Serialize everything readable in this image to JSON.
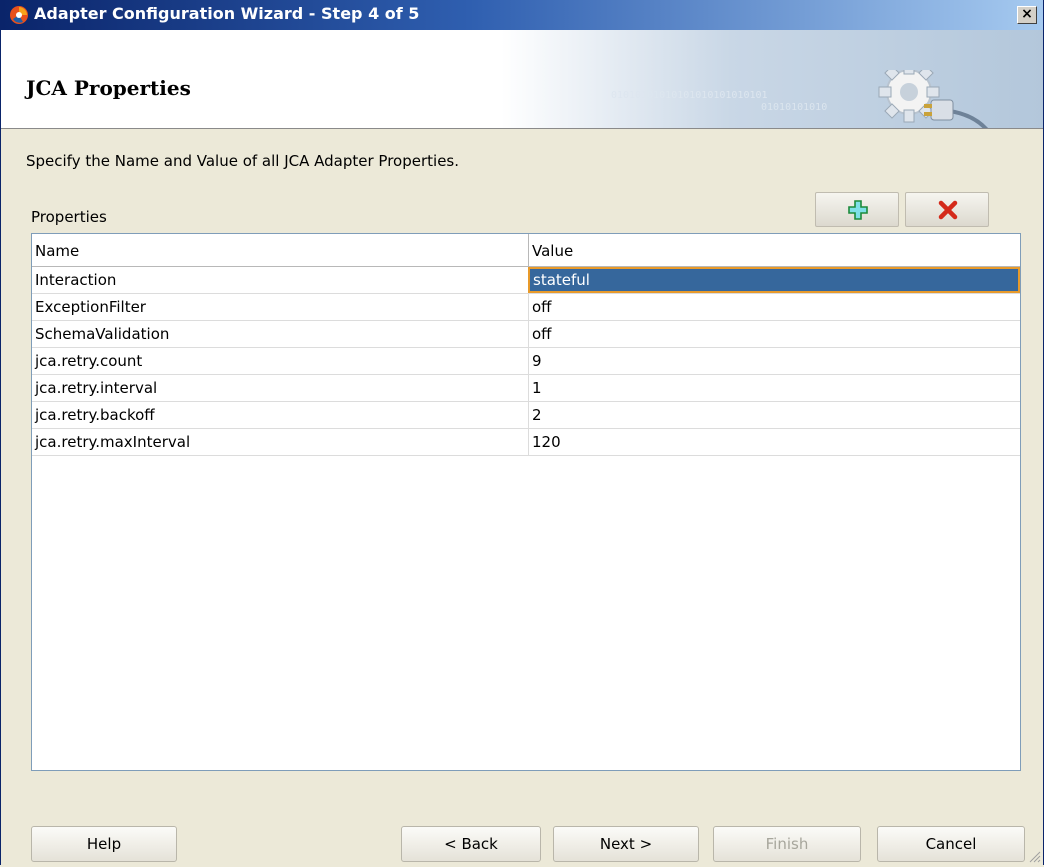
{
  "window": {
    "title": "Adapter Configuration Wizard - Step 4 of 5",
    "close_label": "×"
  },
  "banner": {
    "title": "JCA Properties",
    "binary_text_1": "01010101010101010101010101",
    "binary_text_2": "01010101010"
  },
  "instruction": "Specify the Name and Value of all JCA Adapter Properties.",
  "properties": {
    "label": "Properties",
    "columns": [
      "Name",
      "Value"
    ],
    "rows": [
      {
        "name": "Interaction",
        "value": "stateful",
        "selected": true
      },
      {
        "name": "ExceptionFilter",
        "value": "off"
      },
      {
        "name": "SchemaValidation",
        "value": "off"
      },
      {
        "name": "jca.retry.count",
        "value": "9"
      },
      {
        "name": "jca.retry.interval",
        "value": "1"
      },
      {
        "name": "jca.retry.backoff",
        "value": "2"
      },
      {
        "name": "jca.retry.maxInterval",
        "value": "120"
      }
    ],
    "add_icon": "plus-icon",
    "remove_icon": "delete-x-icon"
  },
  "buttons": {
    "help": "Help",
    "back": "< Back",
    "next": "Next >",
    "finish": "Finish",
    "cancel": "Cancel"
  },
  "colors": {
    "selection_bg": "#36679c",
    "selection_border": "#e89a2a",
    "titlebar": "#0a246a"
  }
}
